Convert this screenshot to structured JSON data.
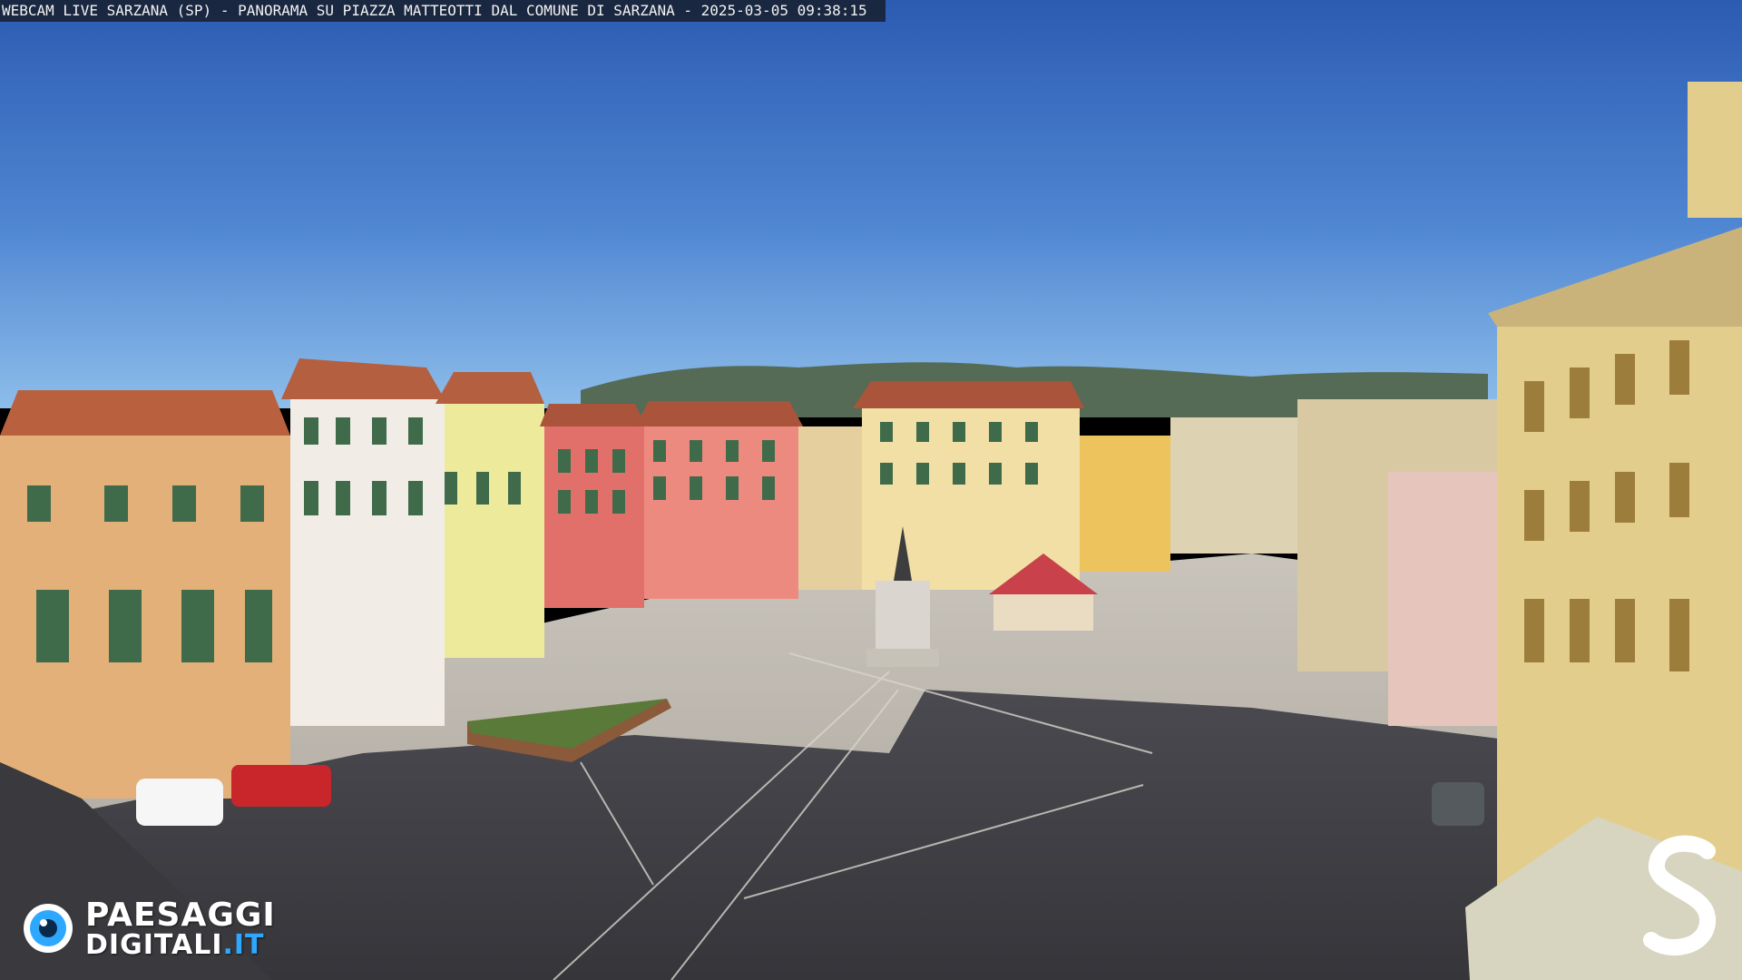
{
  "caption": "WEBCAM LIVE SARZANA (SP) - PANORAMA SU PIAZZA MATTEOTTI DAL COMUNE DI SARZANA - 2025-03-05  09:38:15",
  "logo": {
    "line1": "PAESAGGI",
    "line2_main": "DIGITALI",
    "line2_tld": ".IT",
    "icon": "eye-icon",
    "accent": "#2ea8ff"
  },
  "corner_logo": {
    "letter": "S",
    "icon": "s-monogram-icon"
  },
  "colors": {
    "sky_top": "#2f5fb5",
    "sky_bottom": "#7fb4ea",
    "plaza_light": "#b9b4ab",
    "plaza_shadow": "#3f3f45"
  }
}
